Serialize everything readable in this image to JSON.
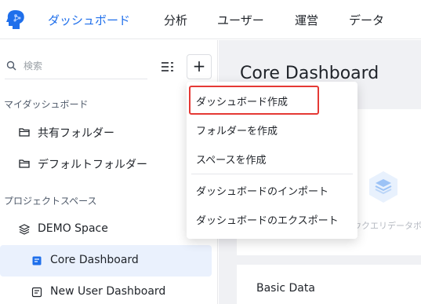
{
  "topnav": {
    "logo_icon": "brain-head-logo",
    "items": [
      {
        "label": "ダッシュボード",
        "active": true
      },
      {
        "label": "分析",
        "active": false
      },
      {
        "label": "ユーザー",
        "active": false
      },
      {
        "label": "運営",
        "active": false
      },
      {
        "label": "データ",
        "active": false
      }
    ]
  },
  "sidebar": {
    "search": {
      "placeholder": "検索",
      "value": ""
    },
    "add_label": "+",
    "sections": [
      {
        "label": "マイダッシュボード"
      },
      {
        "label": "プロジェクトスペース"
      }
    ],
    "items": [
      {
        "label": "共有フォルダー",
        "icon": "folder-icon"
      },
      {
        "label": "デフォルトフォルダー",
        "icon": "folder-icon"
      },
      {
        "label": "DEMO Space",
        "icon": "cube-stack-icon"
      },
      {
        "label": "Core Dashboard",
        "icon": "dashboard-doc-icon",
        "selected": true
      },
      {
        "label": "New User Dashboard",
        "icon": "dashboard-doc-icon"
      }
    ]
  },
  "main": {
    "title": "Core Dashboard",
    "empty_text": "ウクエリデータボ",
    "card2_title": "Basic Data"
  },
  "menu": {
    "items": [
      {
        "label": "ダッシュボード作成",
        "highlighted": true
      },
      {
        "label": "フォルダーを作成"
      },
      {
        "label": "スペースを作成"
      },
      {
        "label": "ダッシュボードのインポート"
      },
      {
        "label": "ダッシュボードのエクスポート"
      }
    ]
  },
  "colors": {
    "accent": "#1f6feb",
    "highlight": "#e53935",
    "selected_bg": "#eaf1fd"
  }
}
